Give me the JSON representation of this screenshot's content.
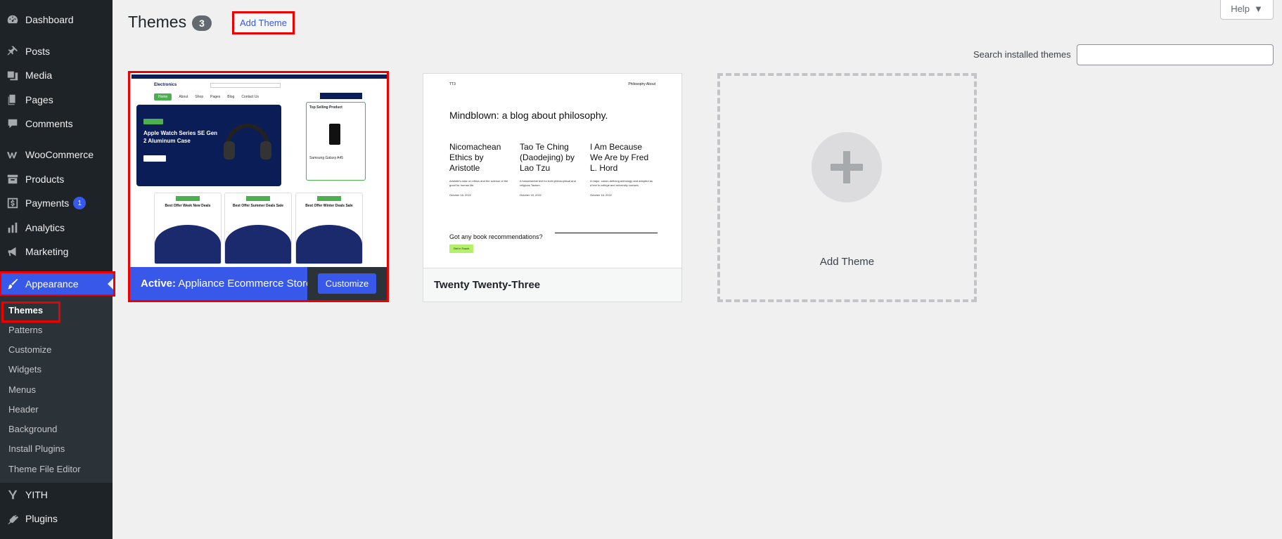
{
  "sidebar": {
    "items": [
      {
        "label": "Dashboard",
        "icon": "dashboard-icon"
      },
      {
        "label": "Posts",
        "icon": "pin-icon"
      },
      {
        "label": "Media",
        "icon": "media-icon"
      },
      {
        "label": "Pages",
        "icon": "pages-icon"
      },
      {
        "label": "Comments",
        "icon": "comment-icon"
      },
      {
        "label": "WooCommerce",
        "icon": "woo-icon"
      },
      {
        "label": "Products",
        "icon": "archive-icon"
      },
      {
        "label": "Payments",
        "icon": "dollar-icon",
        "badge": "1"
      },
      {
        "label": "Analytics",
        "icon": "bar-chart-icon"
      },
      {
        "label": "Marketing",
        "icon": "megaphone-icon"
      },
      {
        "label": "Appearance",
        "icon": "brush-icon"
      },
      {
        "label": "YITH",
        "icon": "yith-icon"
      },
      {
        "label": "Plugins",
        "icon": "plug-icon"
      }
    ],
    "submenu": [
      "Themes",
      "Patterns",
      "Customize",
      "Widgets",
      "Menus",
      "Header",
      "Background",
      "Install Plugins",
      "Theme File Editor"
    ]
  },
  "header": {
    "title": "Themes",
    "count": "3",
    "add_theme": "Add Theme",
    "help": "Help",
    "search_label": "Search installed themes",
    "search_value": ""
  },
  "themes": {
    "active": {
      "prefix": "Active:",
      "name": "Appliance Ecommerce Store",
      "customize": "Customize"
    },
    "second": {
      "name": "Twenty Twenty-Three"
    },
    "add": {
      "label": "Add Theme"
    }
  },
  "preview1": {
    "logo": "Electronics",
    "menu": [
      "Home",
      "About",
      "Shop",
      "Pages",
      "Blog",
      "Contact Us"
    ],
    "hero": "Apple Watch Series SE Gen 2 Aluminum Case",
    "side_title": "Top Selling Product",
    "side_product": "Samsung Galaxy A45",
    "boxes": [
      "Best Offer Week New Deals",
      "Best Offer Summer Deals Sale",
      "Best Offer Winter Deals Sale"
    ]
  },
  "preview2": {
    "site": "TT3",
    "nav": "Philosophy   About",
    "headline": "Mindblown: a blog about philosophy.",
    "posts": [
      {
        "title": "Nicomachean Ethics by Aristotle",
        "excerpt": "Aristotle's take on ethics and the science of the good for human life.",
        "date": "October 18, 2022"
      },
      {
        "title": "Tao Te Ching (Daodejing) by Lao Tzu",
        "excerpt": "A fundamental text for both philosophical and religious Taoism.",
        "date": "October 18, 2022"
      },
      {
        "title": "I Am Because We Are by Fred L. Hord",
        "excerpt": "A major, canon-defining anthology and adopted as a text in college and university courses.",
        "date": "October 18, 2022"
      }
    ],
    "question": "Got any book recommendations?",
    "button": "Get In Touch"
  }
}
